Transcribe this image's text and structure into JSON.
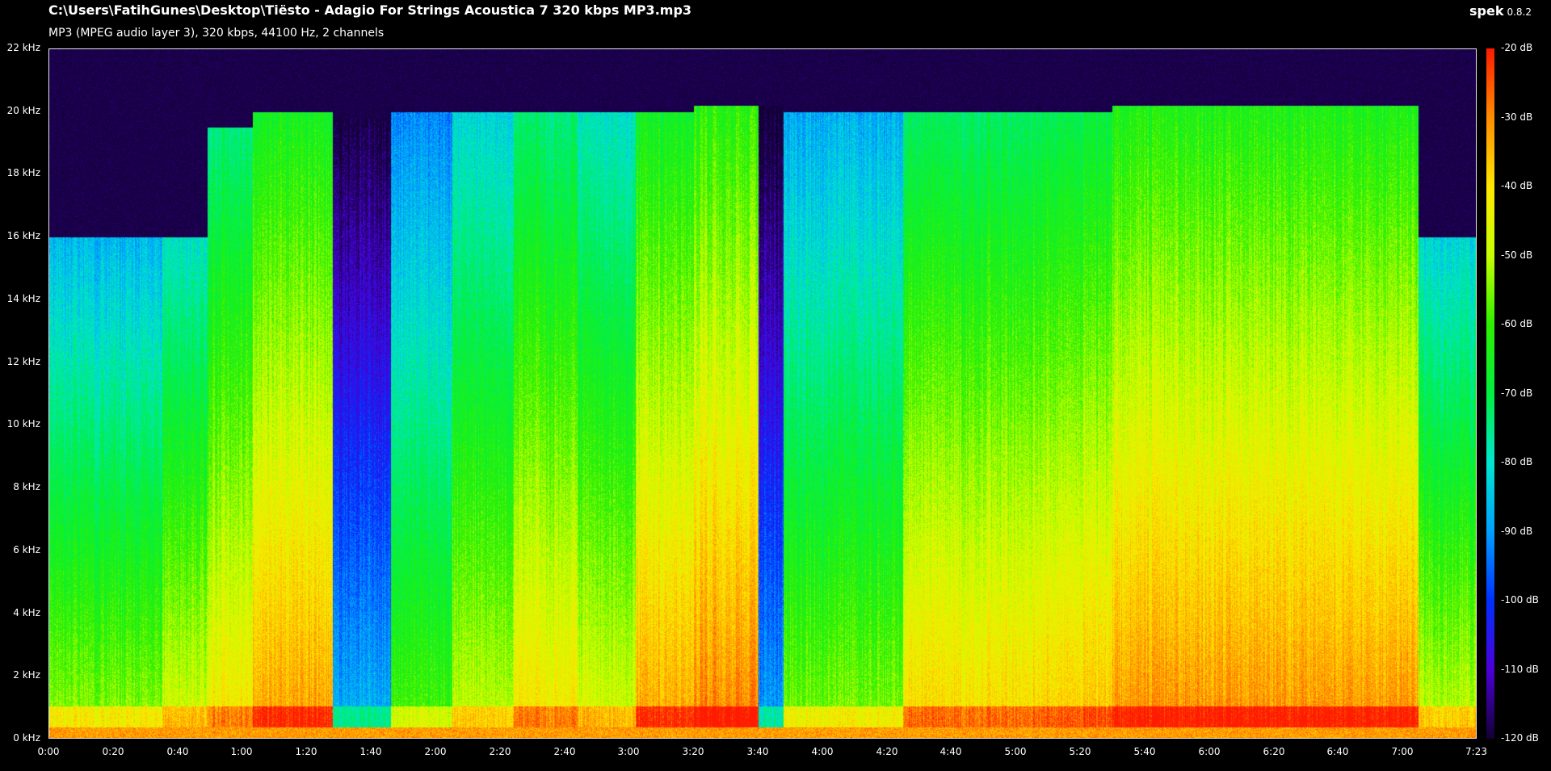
{
  "header": {
    "file_path": "C:\\Users\\FatihGunes\\Desktop\\Tiësto - Adagio For Strings Acoustica 7 320 kbps MP3.mp3",
    "file_info": "MP3 (MPEG audio layer 3), 320 kbps, 44100 Hz, 2 channels"
  },
  "brand": {
    "name": "spek",
    "version": "0.8.2"
  },
  "frequency_axis": {
    "ticks": [
      {
        "value": 22,
        "label": "22 kHz"
      },
      {
        "value": 20,
        "label": "20 kHz"
      },
      {
        "value": 18,
        "label": "18 kHz"
      },
      {
        "value": 16,
        "label": "16 kHz"
      },
      {
        "value": 14,
        "label": "14 kHz"
      },
      {
        "value": 12,
        "label": "12 kHz"
      },
      {
        "value": 10,
        "label": "10 kHz"
      },
      {
        "value": 8,
        "label": "8 kHz"
      },
      {
        "value": 6,
        "label": "6 kHz"
      },
      {
        "value": 4,
        "label": "4 kHz"
      },
      {
        "value": 2,
        "label": "2 kHz"
      },
      {
        "value": 0,
        "label": "0 kHz"
      }
    ],
    "max": 22
  },
  "time_axis": {
    "duration_seconds": 443,
    "ticks": [
      {
        "value": 0,
        "label": "0:00"
      },
      {
        "value": 20,
        "label": "0:20"
      },
      {
        "value": 40,
        "label": "0:40"
      },
      {
        "value": 60,
        "label": "1:00"
      },
      {
        "value": 80,
        "label": "1:20"
      },
      {
        "value": 100,
        "label": "1:40"
      },
      {
        "value": 120,
        "label": "2:00"
      },
      {
        "value": 140,
        "label": "2:20"
      },
      {
        "value": 160,
        "label": "2:40"
      },
      {
        "value": 180,
        "label": "3:00"
      },
      {
        "value": 200,
        "label": "3:20"
      },
      {
        "value": 220,
        "label": "3:40"
      },
      {
        "value": 240,
        "label": "4:00"
      },
      {
        "value": 260,
        "label": "4:20"
      },
      {
        "value": 280,
        "label": "4:40"
      },
      {
        "value": 300,
        "label": "5:00"
      },
      {
        "value": 320,
        "label": "5:20"
      },
      {
        "value": 340,
        "label": "5:40"
      },
      {
        "value": 360,
        "label": "6:00"
      },
      {
        "value": 380,
        "label": "6:20"
      },
      {
        "value": 400,
        "label": "6:40"
      },
      {
        "value": 420,
        "label": "7:00"
      },
      {
        "value": 443,
        "label": "7:23"
      }
    ]
  },
  "db_scale": {
    "ticks": [
      {
        "value": -20,
        "label": "-20 dB"
      },
      {
        "value": -30,
        "label": "-30 dB"
      },
      {
        "value": -40,
        "label": "-40 dB"
      },
      {
        "value": -50,
        "label": "-50 dB"
      },
      {
        "value": -60,
        "label": "-60 dB"
      },
      {
        "value": -70,
        "label": "-70 dB"
      },
      {
        "value": -80,
        "label": "-80 dB"
      },
      {
        "value": -90,
        "label": "-90 dB"
      },
      {
        "value": -100,
        "label": "-100 dB"
      },
      {
        "value": -110,
        "label": "-110 dB"
      },
      {
        "value": -120,
        "label": "-120 dB"
      }
    ],
    "min": -120,
    "max": -20,
    "palette": [
      "#120033",
      "#4b00d8",
      "#0030ff",
      "#00a0ff",
      "#00e6d0",
      "#00f040",
      "#2ef000",
      "#c8ff00",
      "#ffe600",
      "#ff8c00",
      "#ff1a00"
    ]
  },
  "segments": [
    {
      "start": 0,
      "end": 35,
      "level": 0.45,
      "cutoff_khz": 16
    },
    {
      "start": 35,
      "end": 49,
      "level": 0.52,
      "cutoff_khz": 16
    },
    {
      "start": 49,
      "end": 63,
      "level": 0.58,
      "cutoff_khz": 19.5
    },
    {
      "start": 63,
      "end": 88,
      "level": 0.66,
      "cutoff_khz": 20
    },
    {
      "start": 88,
      "end": 106,
      "level": 0.12,
      "cutoff_khz": 19.8
    },
    {
      "start": 106,
      "end": 125,
      "level": 0.4,
      "cutoff_khz": 20
    },
    {
      "start": 125,
      "end": 144,
      "level": 0.5,
      "cutoff_khz": 20
    },
    {
      "start": 144,
      "end": 164,
      "level": 0.58,
      "cutoff_khz": 20
    },
    {
      "start": 164,
      "end": 182,
      "level": 0.52,
      "cutoff_khz": 20
    },
    {
      "start": 182,
      "end": 200,
      "level": 0.66,
      "cutoff_khz": 20
    },
    {
      "start": 200,
      "end": 220,
      "level": 0.7,
      "cutoff_khz": 20.2
    },
    {
      "start": 220,
      "end": 228,
      "level": 0.1,
      "cutoff_khz": 20.2
    },
    {
      "start": 228,
      "end": 265,
      "level": 0.44,
      "cutoff_khz": 20
    },
    {
      "start": 265,
      "end": 305,
      "level": 0.6,
      "cutoff_khz": 20
    },
    {
      "start": 305,
      "end": 330,
      "level": 0.62,
      "cutoff_khz": 20
    },
    {
      "start": 330,
      "end": 425,
      "level": 0.68,
      "cutoff_khz": 20.2
    },
    {
      "start": 425,
      "end": 443,
      "level": 0.5,
      "cutoff_khz": 16
    }
  ]
}
